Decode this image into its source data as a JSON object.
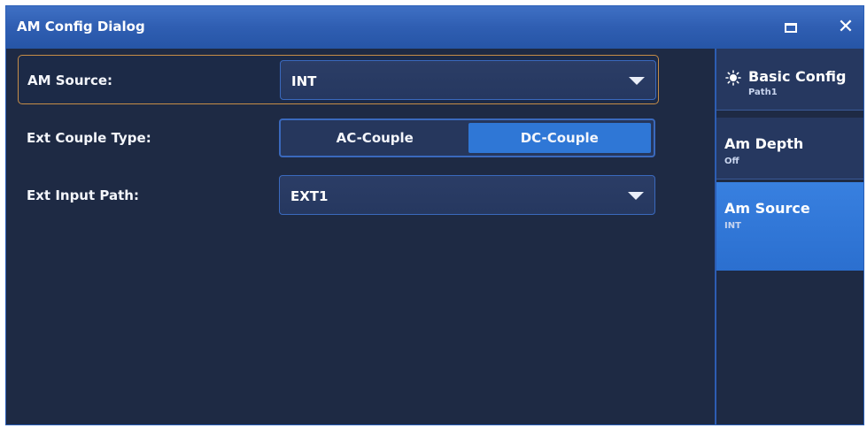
{
  "window": {
    "title": "AM Config Dialog",
    "accent_color": "#2f5eb2",
    "maximize_icon": "maximize-icon",
    "close_icon": "close-icon"
  },
  "form": {
    "am_source": {
      "label": "AM Source:",
      "value": "INT"
    },
    "ext_couple_type": {
      "label": "Ext Couple Type:",
      "options": [
        "AC-Couple",
        "DC-Couple"
      ],
      "selected": "DC-Couple"
    },
    "ext_input_path": {
      "label": "Ext Input Path:",
      "value": "EXT1"
    }
  },
  "sidebar": {
    "items": [
      {
        "label": "Basic Config",
        "sub": "Path1",
        "icon": "gear-icon"
      },
      {
        "label": "Am Depth",
        "sub": "Off"
      },
      {
        "label": "Am Source",
        "sub": "INT",
        "active": true
      }
    ]
  }
}
